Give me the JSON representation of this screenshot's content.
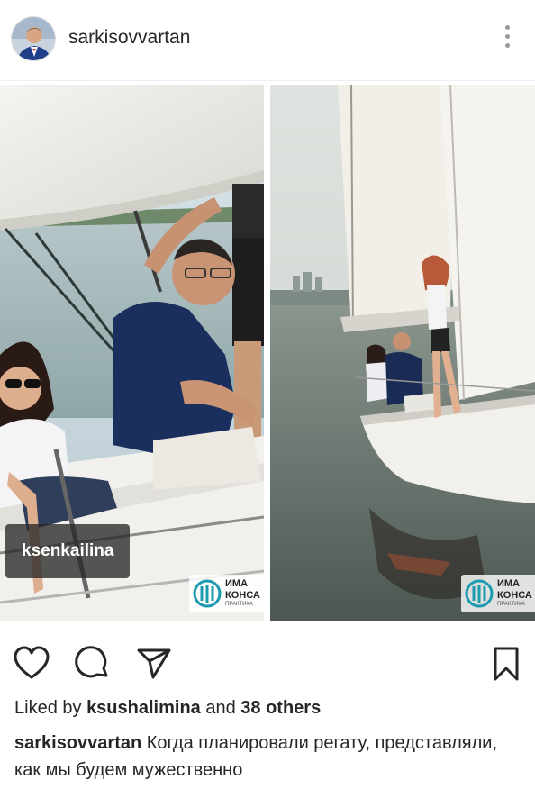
{
  "post": {
    "username": "sarkisovvartan"
  },
  "photos": {
    "tagged_user": "ksenkailina",
    "watermark_line1": "ИМА",
    "watermark_line2": "КОНСА",
    "watermark_line3": "ПРАКТИКА"
  },
  "likes": {
    "prefix": "Liked by",
    "first_user": "ksushalimina",
    "connector": "and",
    "others": "38 others"
  },
  "caption": {
    "username": "sarkisovvartan",
    "text": "Когда планировали регату, представляли, как мы будем мужественно"
  },
  "icons": {
    "more": "more-vertical-icon",
    "like": "heart-icon",
    "comment": "comment-bubble-icon",
    "share": "paper-plane-icon",
    "save": "bookmark-icon",
    "user_tag": "person-icon"
  },
  "colors": {
    "text": "#262626",
    "muted_icon": "#9a9a9a",
    "tag_bg": "#282828",
    "watermark_teal": "#1a9bb0"
  }
}
